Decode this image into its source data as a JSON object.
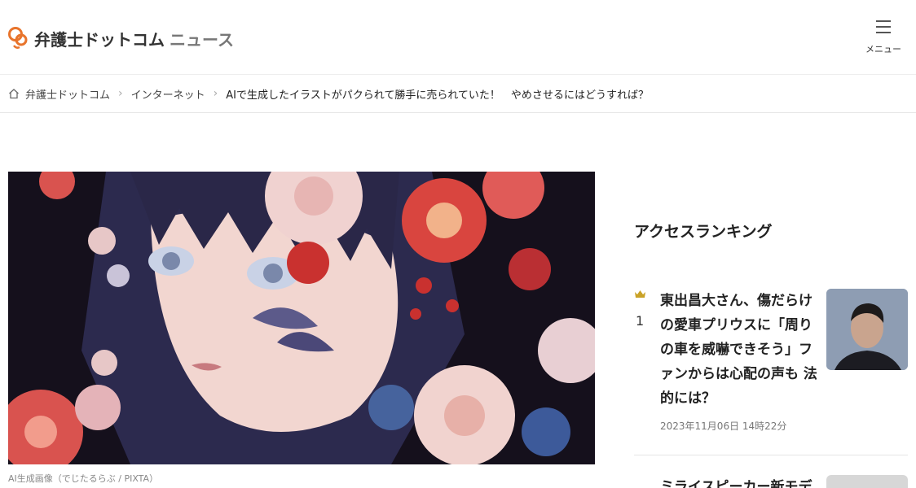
{
  "header": {
    "logo_text": "弁護士ドットコム",
    "logo_sub": "ニュース",
    "menu_label": "メニュー",
    "brand_color": "#e8742c"
  },
  "breadcrumb": {
    "items": [
      {
        "label": "弁護士ドットコム"
      },
      {
        "label": "インターネット"
      },
      {
        "label": "AIで生成したイラストがパクられて勝手に売られていた！　やめさせるにはどうすれば？"
      }
    ]
  },
  "article": {
    "image_caption": "AI生成画像（でじたるらぶ / PIXTA）"
  },
  "ranking": {
    "title": "アクセスランキング",
    "items": [
      {
        "rank": "1",
        "headline": "東出昌大さん、傷だらけの愛車プリウスに「周りの車を威嚇できそう」ファンからは心配の声も 法的には？",
        "date": "2023年11月06日 14時22分",
        "crown_color": "#c9a227"
      },
      {
        "headline": "ミライスピーカー新モデ"
      }
    ]
  }
}
